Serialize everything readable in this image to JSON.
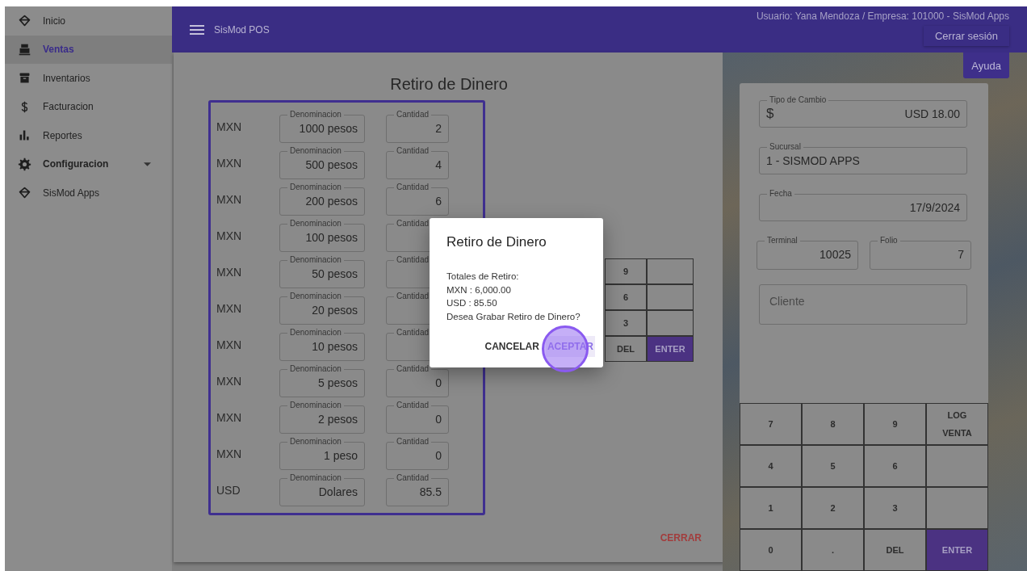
{
  "sidebar": {
    "items": [
      {
        "label": "Inicio",
        "kind": "link",
        "selected": false
      },
      {
        "label": "Ventas",
        "kind": "link",
        "selected": true
      },
      {
        "label": "Inventarios",
        "kind": "link",
        "selected": false
      },
      {
        "label": "Facturacion",
        "kind": "link",
        "selected": false
      },
      {
        "label": "Reportes",
        "kind": "link",
        "selected": false
      },
      {
        "label": "Configuracion",
        "kind": "group",
        "selected": false
      },
      {
        "label": "SisMod Apps",
        "kind": "link",
        "selected": false
      }
    ]
  },
  "header": {
    "title": "SisMod POS",
    "user_info": "Usuario: Yana Mendoza / Empresa: 101000 - SisMod Apps",
    "logout": "Cerrar sesión"
  },
  "help_button": "Ayuda",
  "withdrawal": {
    "title": "Retiro de Dinero",
    "rows": [
      {
        "currency": "MXN",
        "denomination_label": "Denominacion",
        "denomination": "1000 pesos",
        "quantity_label": "Cantidad",
        "quantity": "2"
      },
      {
        "currency": "MXN",
        "denomination_label": "Denominacion",
        "denomination": "500 pesos",
        "quantity_label": "Cantidad",
        "quantity": "4"
      },
      {
        "currency": "MXN",
        "denomination_label": "Denominacion",
        "denomination": "200 pesos",
        "quantity_label": "Cantidad",
        "quantity": "6"
      },
      {
        "currency": "MXN",
        "denomination_label": "Denominacion",
        "denomination": "100 pesos",
        "quantity_label": "Cantidad"
      },
      {
        "currency": "MXN",
        "denomination_label": "Denominacion",
        "denomination": "50 pesos",
        "quantity_label": "Cantidad"
      },
      {
        "currency": "MXN",
        "denomination_label": "Denominacion",
        "denomination": "20 pesos",
        "quantity_label": "Cantidad"
      },
      {
        "currency": "MXN",
        "denomination_label": "Denominacion",
        "denomination": "10 pesos",
        "quantity_label": "Cantidad"
      },
      {
        "currency": "MXN",
        "denomination_label": "Denominacion",
        "denomination": "5 pesos",
        "quantity_label": "Cantidad",
        "quantity": "0"
      },
      {
        "currency": "MXN",
        "denomination_label": "Denominacion",
        "denomination": "2 pesos",
        "quantity_label": "Cantidad",
        "quantity": "0"
      },
      {
        "currency": "MXN",
        "denomination_label": "Denominacion",
        "denomination": "1 peso",
        "quantity_label": "Cantidad",
        "quantity": "0"
      },
      {
        "currency": "USD",
        "denomination_label": "Denominacion",
        "denomination": "Dolares",
        "quantity_label": "Cantidad",
        "quantity": "85.5"
      }
    ],
    "keypad": [
      {
        "kind": "digit",
        "label": "9"
      },
      {
        "kind": "blank"
      },
      {
        "kind": "digit",
        "label": "6"
      },
      {
        "kind": "blank"
      },
      {
        "kind": "digit",
        "label": "3"
      },
      {
        "kind": "blank"
      },
      {
        "kind": "digit",
        "label": "DEL"
      },
      {
        "kind": "primary",
        "label": "ENTER"
      }
    ],
    "close": "CERRAR"
  },
  "dialog": {
    "title": "Retiro de Dinero",
    "lines": [
      "Totales de Retiro:",
      "MXN : 6,000.00",
      "USD : 85.50",
      "Desea Grabar Retiro de Dinero?"
    ],
    "cancel": "CANCELAR",
    "accept": "ACEPTAR",
    "accept_focused": true
  },
  "sale_panel": {
    "exchange": {
      "label": "Tipo de Cambio",
      "prefix": "$",
      "value": "USD 18.00"
    },
    "branch": {
      "label": "Sucursal",
      "value": "1 - SISMOD APPS"
    },
    "date": {
      "label": "Fecha",
      "value": "17/9/2024"
    },
    "terminal": {
      "label": "Terminal",
      "value": "10025"
    },
    "folio": {
      "label": "Folio",
      "value": "7"
    },
    "client": {
      "placeholder": "Cliente"
    },
    "keypad": [
      {
        "kind": "digit",
        "label": "7"
      },
      {
        "kind": "digit",
        "label": "8"
      },
      {
        "kind": "digit",
        "label": "9"
      },
      {
        "kind": "action",
        "label": "LOG VENTA"
      },
      {
        "kind": "digit",
        "label": "4"
      },
      {
        "kind": "digit",
        "label": "5"
      },
      {
        "kind": "digit",
        "label": "6"
      },
      {
        "kind": "blank"
      },
      {
        "kind": "digit",
        "label": "1"
      },
      {
        "kind": "digit",
        "label": "2"
      },
      {
        "kind": "digit",
        "label": "3"
      },
      {
        "kind": "blank"
      },
      {
        "kind": "digit",
        "label": "0"
      },
      {
        "kind": "digit",
        "label": "."
      },
      {
        "kind": "digit",
        "label": "DEL"
      },
      {
        "kind": "primary",
        "label": "ENTER"
      }
    ]
  }
}
